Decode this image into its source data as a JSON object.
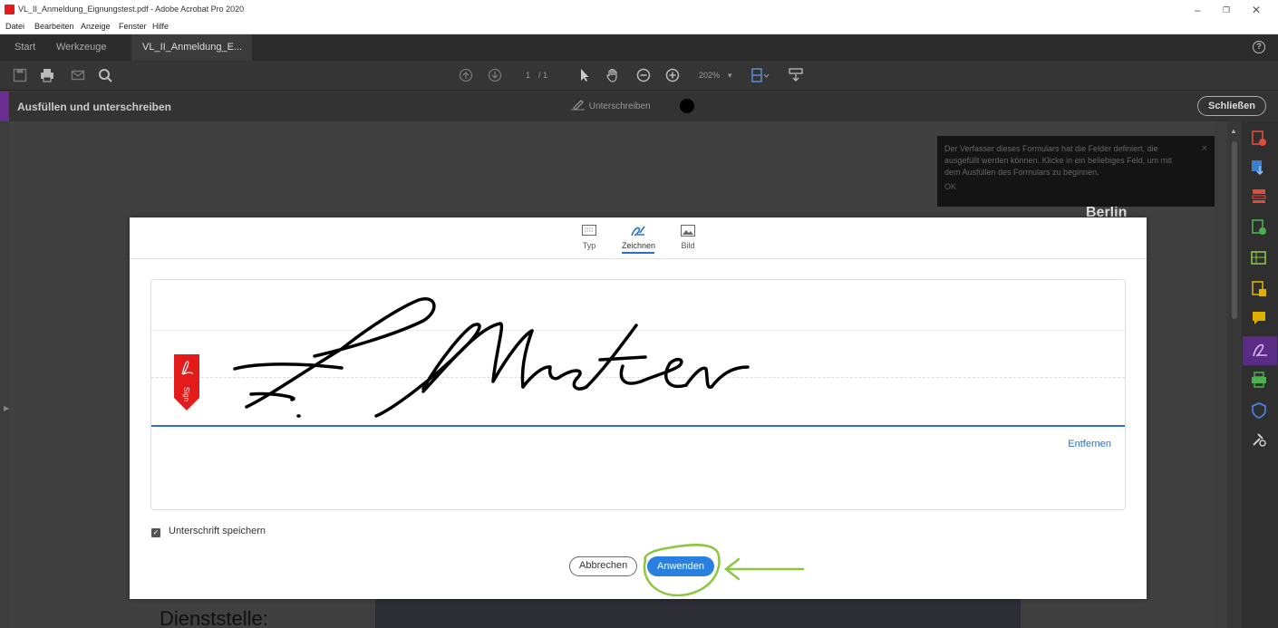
{
  "window": {
    "title": "VL_II_Anmeldung_Eignungstest.pdf - Adobe Acrobat Pro 2020",
    "controls": [
      "–",
      "❐",
      "✕"
    ]
  },
  "menu": [
    "Datei",
    "Bearbeiten",
    "Anzeige",
    "Fenster",
    "Hilfe"
  ],
  "tabs": {
    "start": "Start",
    "tools": "Werkzeuge",
    "document": "VL_II_Anmeldung_E...",
    "close": "×",
    "help": "?"
  },
  "toolbar": {
    "page_current": "1",
    "page_total": "/ 1",
    "zoom": "202%",
    "zoom_arrow": "▾"
  },
  "fillsign": {
    "title": "Ausfüllen und unterschreiben",
    "sign_label": "Unterschreiben",
    "close_label": "Schließen",
    "ink_color": "#000000"
  },
  "document": {
    "field_label": "Dienststelle:",
    "partial_text": "Berlin"
  },
  "tooltip": {
    "text": "Der Verfasser dieses Formulars hat die Felder definiert, die ausgefüllt werden können. Klicke in ein beliebiges Feld, um mit dem Ausfüllen des Formulars zu beginnen.",
    "ok": "OK",
    "close": "×"
  },
  "dialog": {
    "tabs": [
      {
        "label": "Typ",
        "icon": "keyboard-icon"
      },
      {
        "label": "Zeichnen",
        "icon": "pen-icon",
        "active": true
      },
      {
        "label": "Bild",
        "icon": "image-icon"
      }
    ],
    "sign_flag_text": "Sign",
    "remove_label": "Entfernen",
    "save_label": "Unterschrift speichern",
    "save_checked": true,
    "cancel_label": "Abbrechen",
    "apply_label": "Anwenden"
  },
  "colors": {
    "accent_blue": "#2a80e0",
    "sign_red": "#e31b1b",
    "annotation_green": "#8cc63f",
    "fillsign_purple": "#6a2d91"
  }
}
